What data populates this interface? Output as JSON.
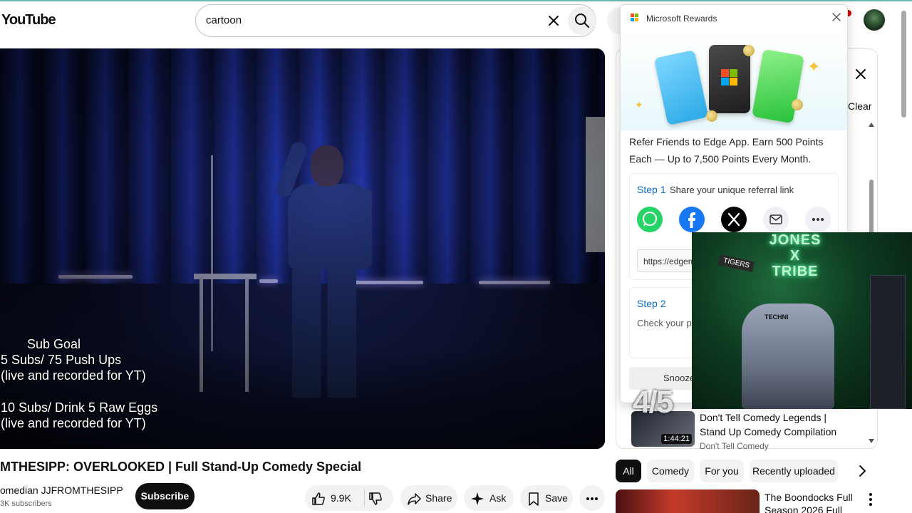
{
  "header": {
    "logo": "YouTube",
    "search_value": "cartoon"
  },
  "video": {
    "overlay_lines": [
      "Sub Goal",
      "5 Subs/ 75 Push Ups",
      "(live and recorded for YT)",
      "10 Subs/ Drink 5 Raw Eggs",
      "(live and recorded for YT)"
    ],
    "title": "MTHESIPP: OVERLOOKED | Full Stand-Up Comedy Special",
    "channel": "omedian JJFROMTHESIPP",
    "subscribers": "3K subscribers",
    "subscribe_label": "Subscribe",
    "like_count": "9.9K",
    "share_label": "Share",
    "ask_label": "Ask",
    "save_label": "Save"
  },
  "panel": {
    "clear_label": "Clear",
    "recommendation": {
      "title": "Don't Tell Comedy Legends | Stand Up Comedy Compilation",
      "channel": "Don't Tell Comedy",
      "duration": "1:44:21"
    }
  },
  "chips": [
    "All",
    "Comedy",
    "For you",
    "Recently uploaded"
  ],
  "recommendation2": {
    "title": "The Boondocks Full Season 2026 Full"
  },
  "rewards": {
    "title": "Microsoft Rewards",
    "heading": "Refer Friends to Edge App. Earn 500 Points Each — Up to 7,500 Points Every Month.",
    "step1_label": "Step 1",
    "step1_desc": "Share your unique referral link",
    "link": "https://edgem",
    "step2_label": "Step 2",
    "step2_desc": "Check your pr Edge mobile a",
    "snooze_label": "Snooze"
  },
  "webcam": {
    "neon_line1": "JONES",
    "neon_line2": "X",
    "neon_line3": "TRIBE",
    "chair_logo": "TECHNI",
    "watermark": "4/5"
  },
  "colors": {
    "youtube_red": "#cc0000",
    "link_blue": "#0b6bcb",
    "whatsapp": "#25d366",
    "facebook": "#1877f2"
  }
}
